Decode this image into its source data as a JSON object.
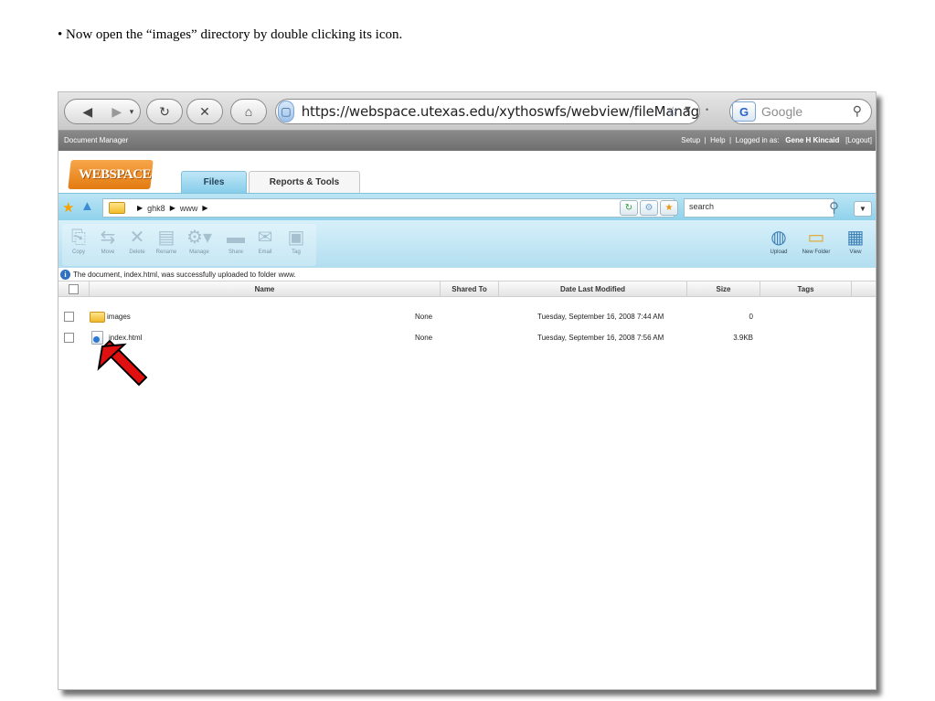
{
  "instruction": "• Now open the “images” directory by double clicking its icon.",
  "browser": {
    "url": "https://webspace.utexas.edu/xythoswfs/webview/fileManag",
    "search_placeholder": "Google",
    "search_engine_letter": "G"
  },
  "doc_bar": {
    "title": "Document Manager",
    "setup": "Setup",
    "help": "Help",
    "logged_in_as": "Logged in as:",
    "user": "Gene H Kincaid",
    "logout": "[Logout]",
    "sep": "|"
  },
  "logo": "WEBSPACE",
  "tabs": [
    {
      "label": "Files",
      "active": true
    },
    {
      "label": "Reports & Tools",
      "active": false
    }
  ],
  "path": {
    "crumbs": [
      "ghk8",
      "www"
    ],
    "search_value": "search"
  },
  "toolbar": {
    "left": [
      {
        "label": "Copy",
        "icon": "copy-icon"
      },
      {
        "label": "Move",
        "icon": "move-icon"
      },
      {
        "label": "Delete",
        "icon": "delete-icon"
      },
      {
        "label": "Rename",
        "icon": "rename-icon"
      },
      {
        "label": "Manage",
        "icon": "manage-icon"
      },
      {
        "label": "Share",
        "icon": "share-icon"
      },
      {
        "label": "Email",
        "icon": "email-icon"
      },
      {
        "label": "Tag",
        "icon": "tag-icon"
      }
    ],
    "right": [
      {
        "label": "Upload",
        "icon": "upload-icon"
      },
      {
        "label": "New Folder",
        "icon": "new-folder-icon"
      },
      {
        "label": "View",
        "icon": "view-icon"
      }
    ]
  },
  "status_message": "The document, index.html, was successfully uploaded to folder www.",
  "table": {
    "headers": [
      "Name",
      "Shared To",
      "Date Last Modified",
      "Size",
      "Tags"
    ],
    "rows": [
      {
        "name": "images",
        "type": "folder",
        "shared": "None",
        "modified": "Tuesday, September 16, 2008 7:44 AM",
        "size": "0",
        "tags": ""
      },
      {
        "name": "index.html",
        "type": "html",
        "shared": "None",
        "modified": "Tuesday, September 16, 2008 7:56 AM",
        "size": "3.9KB",
        "tags": ""
      }
    ]
  },
  "colors": {
    "accent": "#8fd2ec",
    "arrow": "#e01010",
    "logo": "#e37b11"
  }
}
